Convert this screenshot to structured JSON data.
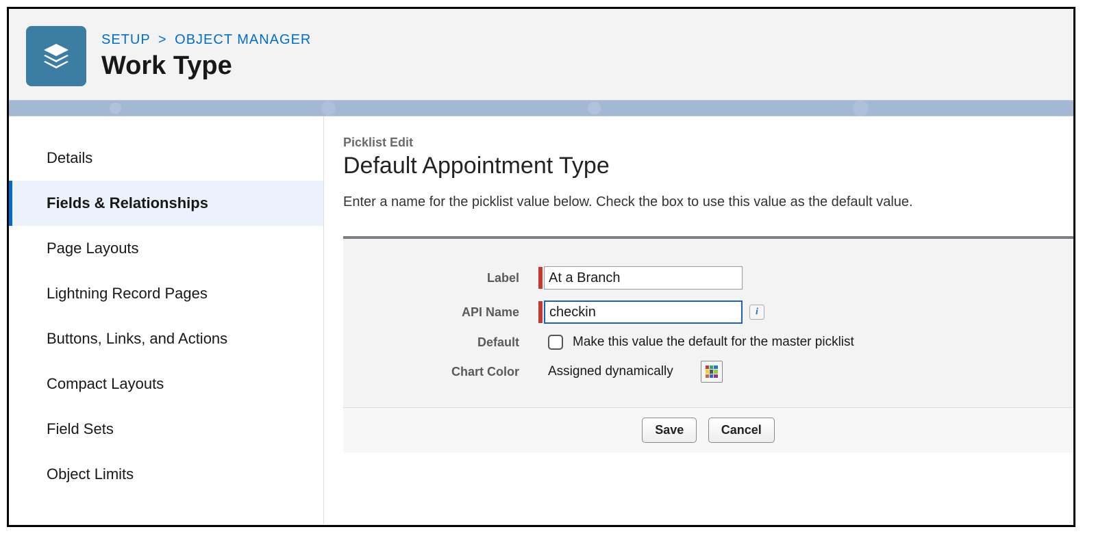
{
  "breadcrumb": {
    "setup": "SETUP",
    "sep": ">",
    "object_manager": "OBJECT MANAGER"
  },
  "page_title": "Work Type",
  "sidebar": {
    "items": [
      {
        "label": "Details",
        "active": false
      },
      {
        "label": "Fields & Relationships",
        "active": true
      },
      {
        "label": "Page Layouts",
        "active": false
      },
      {
        "label": "Lightning Record Pages",
        "active": false
      },
      {
        "label": "Buttons, Links, and Actions",
        "active": false
      },
      {
        "label": "Compact Layouts",
        "active": false
      },
      {
        "label": "Field Sets",
        "active": false
      },
      {
        "label": "Object Limits",
        "active": false
      }
    ]
  },
  "content": {
    "eyebrow": "Picklist Edit",
    "title": "Default Appointment Type",
    "description": "Enter a name for the picklist value below. Check the box to use this value as the default value.",
    "form": {
      "label_field": {
        "label": "Label",
        "value": "At a Branch"
      },
      "api_name_field": {
        "label": "API Name",
        "value": "checkin",
        "info_tooltip": "i"
      },
      "default_field": {
        "label": "Default",
        "checkbox_label": "Make this value the default for the master picklist",
        "checked": false
      },
      "chart_color_field": {
        "label": "Chart Color",
        "value": "Assigned dynamically"
      }
    },
    "buttons": {
      "save": "Save",
      "cancel": "Cancel"
    }
  }
}
